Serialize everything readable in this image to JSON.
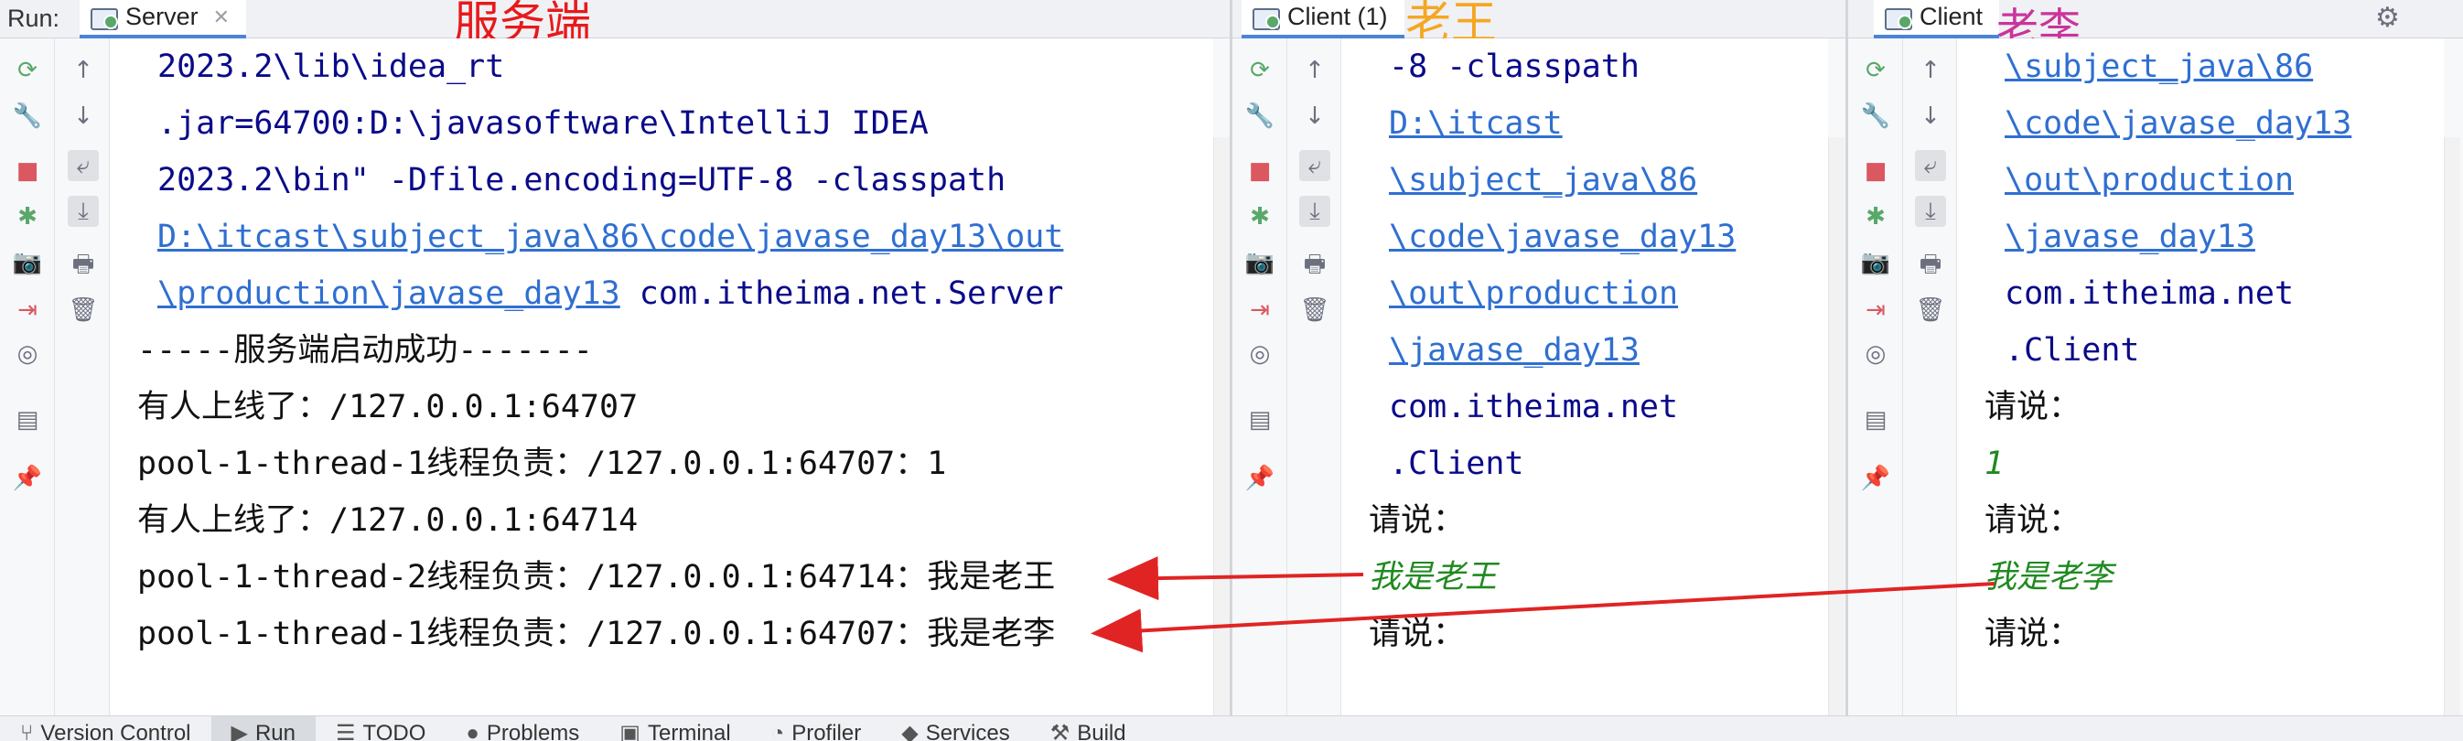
{
  "run_label": "Run:",
  "panels": [
    {
      "tab": "Server",
      "has_close": true,
      "annotation": "服务端",
      "annotation_color": "#e8191b",
      "lines": [
        {
          "type": "cmd",
          "text": "2023.2\\lib\\idea_rt"
        },
        {
          "type": "cmd",
          "text": ".jar=64700:D:\\javasoftware\\IntelliJ IDEA"
        },
        {
          "type": "cmd",
          "text": "2023.2\\bin\" -Dfile.encoding=UTF-8 -classpath"
        },
        {
          "type": "link",
          "text": "D:\\itcast\\subject_java\\86\\code\\javase_day13\\out"
        },
        {
          "type": "mixed",
          "link": "\\production\\javase_day13",
          "text": " com.itheima.net.Server"
        },
        {
          "type": "out",
          "text": "-----服务端启动成功-------"
        },
        {
          "type": "out",
          "text": "有人上线了：/127.0.0.1:64707"
        },
        {
          "type": "out",
          "text": "pool-1-thread-1线程负责：/127.0.0.1:64707：1"
        },
        {
          "type": "out",
          "text": "有人上线了：/127.0.0.1:64714"
        },
        {
          "type": "out",
          "text": "pool-1-thread-2线程负责：/127.0.0.1:64714：我是老王"
        },
        {
          "type": "out",
          "text": "pool-1-thread-1线程负责：/127.0.0.1:64707：我是老李"
        }
      ]
    },
    {
      "tab": "Client (1)",
      "has_close": false,
      "annotation": "老王",
      "annotation_color": "#f5a623",
      "lines": [
        {
          "type": "cmd",
          "text": "-8 -classpath"
        },
        {
          "type": "link",
          "text": "D:\\itcast"
        },
        {
          "type": "link",
          "text": "\\subject_java\\86"
        },
        {
          "type": "link",
          "text": "\\code\\javase_day13"
        },
        {
          "type": "link",
          "text": "\\out\\production"
        },
        {
          "type": "link",
          "text": "\\javase_day13"
        },
        {
          "type": "cmd",
          "text": "com.itheima.net"
        },
        {
          "type": "cmd",
          "text": ".Client"
        },
        {
          "type": "out",
          "text": "请说："
        },
        {
          "type": "input",
          "text": "我是老王"
        },
        {
          "type": "out",
          "text": "请说："
        }
      ]
    },
    {
      "tab": "Client",
      "has_close": false,
      "annotation": "老李",
      "annotation_color": "#c9349b",
      "lines": [
        {
          "type": "link",
          "text": "\\subject_java\\86"
        },
        {
          "type": "link",
          "text": "\\code\\javase_day13"
        },
        {
          "type": "link",
          "text": "\\out\\production"
        },
        {
          "type": "link",
          "text": "\\javase_day13"
        },
        {
          "type": "cmd",
          "text": "com.itheima.net"
        },
        {
          "type": "cmd",
          "text": ".Client"
        },
        {
          "type": "out",
          "text": "请说："
        },
        {
          "type": "input",
          "text": "1"
        },
        {
          "type": "out",
          "text": "请说："
        },
        {
          "type": "input",
          "text": "我是老李"
        },
        {
          "type": "out",
          "text": "请说："
        }
      ]
    }
  ],
  "gutter_icons": [
    "rerun-icon",
    "wrench-icon",
    "stop-icon",
    "debug-icon",
    "camera-icon",
    "login-icon",
    "inspect-icon",
    "layout-icon",
    "pin-icon"
  ],
  "gutter2_icons": [
    "up-arrow-icon",
    "down-arrow-icon",
    "soft-wrap-icon",
    "scroll-to-end-icon",
    "print-icon",
    "trash-icon"
  ],
  "bottom_tabs": [
    {
      "label": "Version Control",
      "icon": "branch-icon"
    },
    {
      "label": "Run",
      "icon": "play-icon",
      "active": true
    },
    {
      "label": "TODO",
      "icon": "list-icon"
    },
    {
      "label": "Problems",
      "icon": "problems-icon"
    },
    {
      "label": "Terminal",
      "icon": "terminal-icon"
    },
    {
      "label": "Profiler",
      "icon": "profiler-icon"
    },
    {
      "label": "Services",
      "icon": "services-icon"
    },
    {
      "label": "Build",
      "icon": "hammer-icon"
    }
  ],
  "arrow_color": "#e02424"
}
